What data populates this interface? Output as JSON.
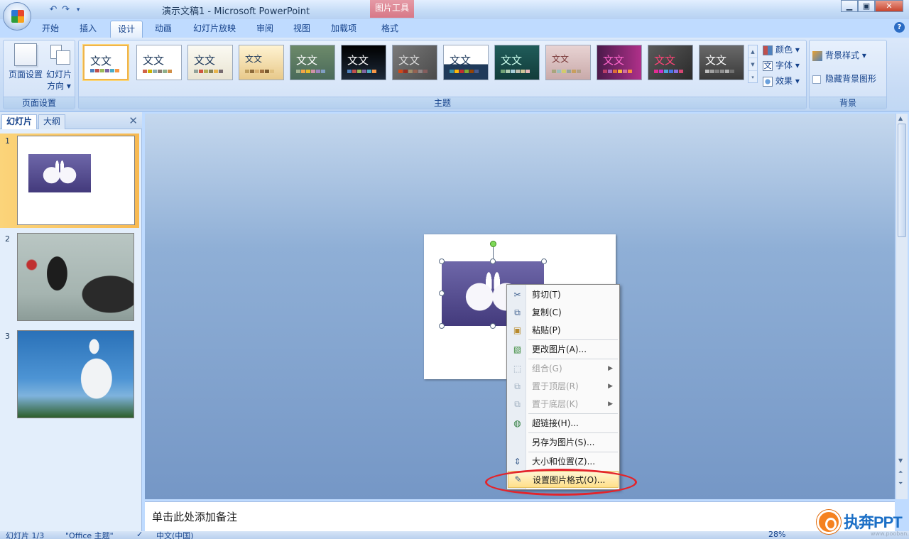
{
  "window": {
    "title": "演示文稿1 - Microsoft PowerPoint",
    "context_tool": "图片工具"
  },
  "tabs": [
    "开始",
    "插入",
    "设计",
    "动画",
    "幻灯片放映",
    "审阅",
    "视图",
    "加载项",
    "格式"
  ],
  "active_tab": "设计",
  "ribbon": {
    "page_setup": {
      "label": "页面设置",
      "page_setup_btn": "页面设置",
      "orientation_btn_line1": "幻灯片",
      "orientation_btn_line2": "方向 ▾"
    },
    "themes": {
      "label": "主题",
      "sample_text": "文文",
      "colors": "颜色 ▾",
      "fonts": "字体 ▾",
      "effects": "效果 ▾"
    },
    "background": {
      "label": "背景",
      "styles": "背景样式 ▾",
      "hide": "隐藏背景图形"
    }
  },
  "left_pane": {
    "tab_slides": "幻灯片",
    "tab_outline": "大纲",
    "slides": [
      {
        "num": "1",
        "image": "swans"
      },
      {
        "num": "2",
        "image": "black-swan"
      },
      {
        "num": "3",
        "image": "white-horse"
      }
    ]
  },
  "context_menu": {
    "items": [
      {
        "label": "剪切(T)",
        "icon": "scissors-icon",
        "disabled": false
      },
      {
        "label": "复制(C)",
        "icon": "copy-icon",
        "disabled": false
      },
      {
        "label": "粘贴(P)",
        "icon": "paste-icon",
        "disabled": false
      },
      {
        "label": "更改图片(A)...",
        "icon": "change-picture-icon",
        "disabled": false
      },
      {
        "label": "组合(G)",
        "icon": "group-icon",
        "disabled": true,
        "submenu": true
      },
      {
        "label": "置于顶层(R)",
        "icon": "bring-front-icon",
        "disabled": true,
        "submenu": true
      },
      {
        "label": "置于底层(K)",
        "icon": "send-back-icon",
        "disabled": true,
        "submenu": true
      },
      {
        "label": "超链接(H)...",
        "icon": "hyperlink-icon",
        "disabled": false
      },
      {
        "label": "另存为图片(S)...",
        "icon": "none",
        "disabled": false
      },
      {
        "label": "大小和位置(Z)...",
        "icon": "size-position-icon",
        "disabled": false
      },
      {
        "label": "设置图片格式(O)...",
        "icon": "format-picture-icon",
        "disabled": false,
        "highlighted": true
      }
    ]
  },
  "notes": {
    "placeholder": "单击此处添加备注"
  },
  "statusbar": {
    "slide_info": "幻灯片 1/3",
    "theme": "\"Office 主题\"",
    "language": "中文(中国)",
    "zoom": "28%"
  },
  "watermark": {
    "text": "执奔PPT",
    "url": "www.pooban.com"
  }
}
